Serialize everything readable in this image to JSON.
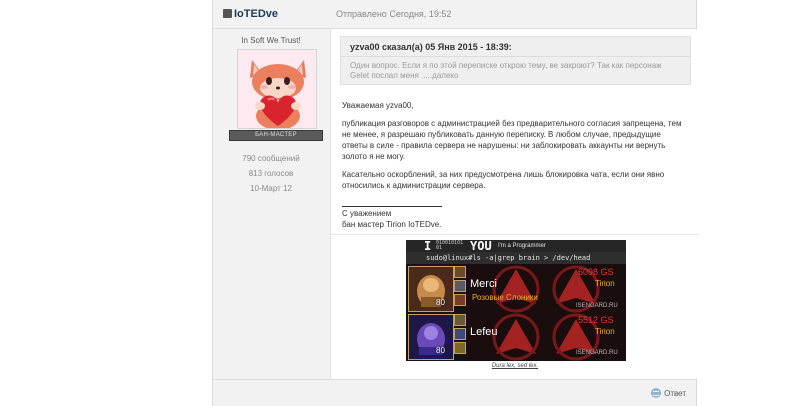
{
  "post": {
    "author": "IoTEDve",
    "date": "Отправлено Сегодня, 19:52"
  },
  "user": {
    "title": "In Soft We Trust!",
    "group": "БАН-МАСТЕР",
    "online_badge": "↑",
    "posts": "790 сообщений",
    "votes": "813 голосов",
    "joined": "10-Март 12"
  },
  "quote": {
    "header": "yzva00 сказал(а) 05 Янв 2015 - 18:39:",
    "text": "Один вопрос. Если я по этой переписке открою тему, ве закроют? Так как персонаж Gelet послал меня .....далеко"
  },
  "body": {
    "greeting": "Уважаемая yzva00,",
    "p1": "публикация разговоров с администрацией без предварительного согласия запрещена, тем не менее, я разрешаю публиковать данную переписку. В любом случае, предыдущие ответы в силе - правила сервера не нарушены: ни заблокировать аккаунты ни вернуть золото я не могу.",
    "p2": "Касательно оскорблений, за них предусмотрена лишь блокировка чата, если они явно относились к администрации сервера.",
    "sig1": "С уважением",
    "sig2": "бан мастер Tirion IoTEDve."
  },
  "banner": {
    "heading_left": "I",
    "heading_bits": "01001010101",
    "heading_right": "YOU",
    "heading_tag": "I'm a Programmer",
    "command": "sudo@linux#ls -a|grep brain > /dev/head",
    "chars": [
      {
        "name": "Merci",
        "gs": "6098 GS",
        "realm": "Tirion",
        "guild": "Розовые Слоники",
        "level": "80",
        "site": "ISENGARD.RU"
      },
      {
        "name": "Lefeu",
        "gs": "5512 GS",
        "realm": "Tirion",
        "guild": "",
        "level": "80",
        "site": "ISENGARD.RU"
      }
    ],
    "caption": "Dura lex, sed lex."
  },
  "footer": {
    "reply": "Ответ"
  },
  "colors": {
    "gs": "#e03a3a",
    "realm": "#e8b020",
    "guild": "#e8b020",
    "author": "#1a3a5a"
  }
}
